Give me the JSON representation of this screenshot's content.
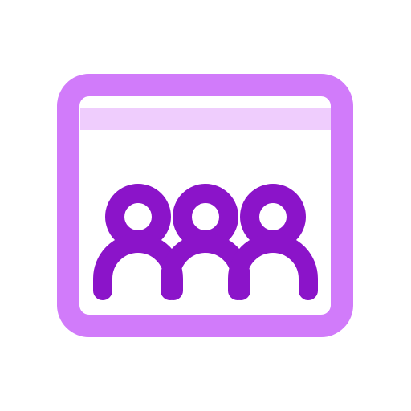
{
  "icon": {
    "name": "group-window-icon",
    "colors": {
      "frame": "#d17bfa",
      "title_bar": "#efcdfd",
      "people": "#8b14c9",
      "background": "#ffffff"
    },
    "people_count": 3
  }
}
